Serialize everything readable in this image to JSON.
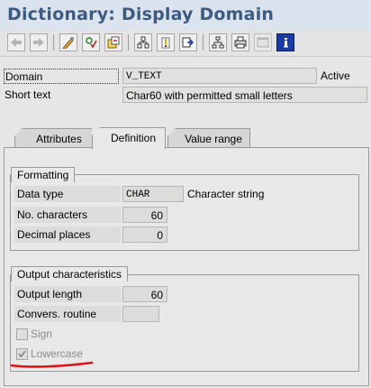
{
  "window": {
    "title": "Dictionary: Display Domain"
  },
  "toolbar": [
    {
      "name": "back-icon"
    },
    {
      "name": "forward-icon"
    },
    {
      "name": "display-change-icon"
    },
    {
      "name": "check-icon"
    },
    {
      "name": "activate-icon"
    },
    {
      "name": "where-used-icon"
    },
    {
      "name": "object-list-icon"
    },
    {
      "name": "navigation-window-icon"
    },
    {
      "name": "hierarchy-icon"
    },
    {
      "name": "print-icon"
    },
    {
      "name": "window-icon"
    },
    {
      "name": "info-icon"
    }
  ],
  "header": {
    "domain_label": "Domain",
    "domain_value": "V_TEXT",
    "status": "Active",
    "short_text_label": "Short text",
    "short_text_value": "Char60 with permitted small letters"
  },
  "tabs": [
    {
      "label": "Attributes",
      "active": false
    },
    {
      "label": "Definition",
      "active": true
    },
    {
      "label": "Value range",
      "active": false
    }
  ],
  "formatting": {
    "title": "Formatting",
    "data_type_label": "Data type",
    "data_type_value": "CHAR",
    "data_type_desc": "Character string",
    "no_characters_label": "No. characters",
    "no_characters_value": "60",
    "decimal_places_label": "Decimal places",
    "decimal_places_value": "0"
  },
  "output": {
    "title": "Output characteristics",
    "output_length_label": "Output length",
    "output_length_value": "60",
    "convers_routine_label": "Convers. routine",
    "convers_routine_value": "",
    "sign_label": "Sign",
    "sign_checked": false,
    "lowercase_label": "Lowercase",
    "lowercase_checked": true
  },
  "colors": {
    "title": "#3d5a80",
    "annotation_underline": "#e01010",
    "info": "#1a3aa8"
  }
}
